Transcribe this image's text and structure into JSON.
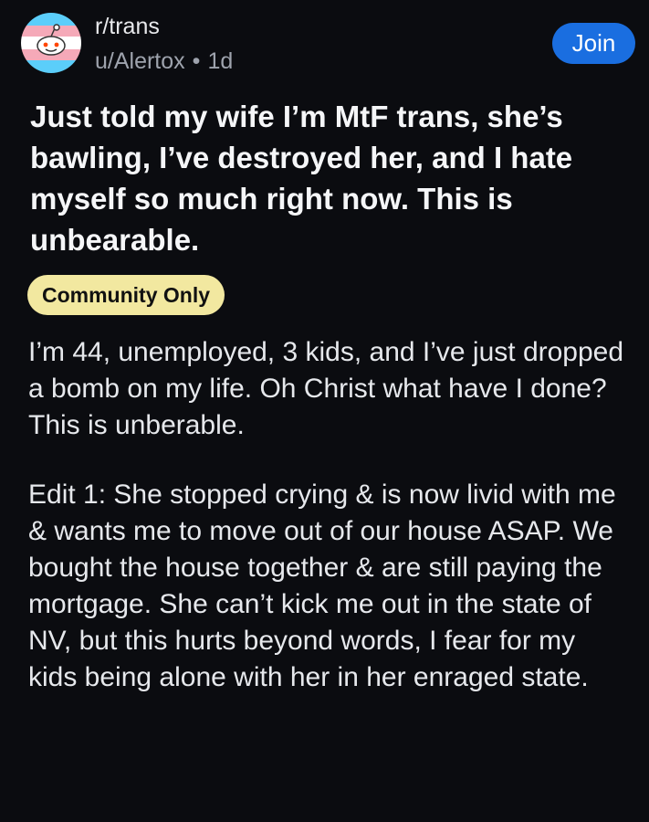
{
  "post": {
    "subreddit": "r/trans",
    "author": "u/Alertox",
    "separator": "•",
    "age": "1d",
    "join_label": "Join",
    "title": "Just told my wife I’m MtF trans, she’s bawling, I’ve destroyed her, and I hate myself so much right now. This is unbearable.",
    "flair": "Community Only",
    "paragraphs": [
      "I’m 44, unemployed, 3 kids, and I’ve just dropped a bomb on my life. Oh Christ what have I done? This is unberable.",
      "Edit 1: She stopped crying & is now livid with me & wants me to move out of our house ASAP. We bought the house together & are still paying the mortgage. She can’t kick me out in the state of NV, but this hurts beyond words, I fear for my kids being alone with her in her enraged state."
    ]
  },
  "colors": {
    "background": "#0b0c10",
    "join_button": "#1a6ee0",
    "flair_background": "#f2e8a0",
    "avatar_blue": "#5bcefa",
    "avatar_pink": "#f5a9b8"
  },
  "icons": {
    "avatar": "subreddit-avatar-trans-flag-snoo"
  }
}
